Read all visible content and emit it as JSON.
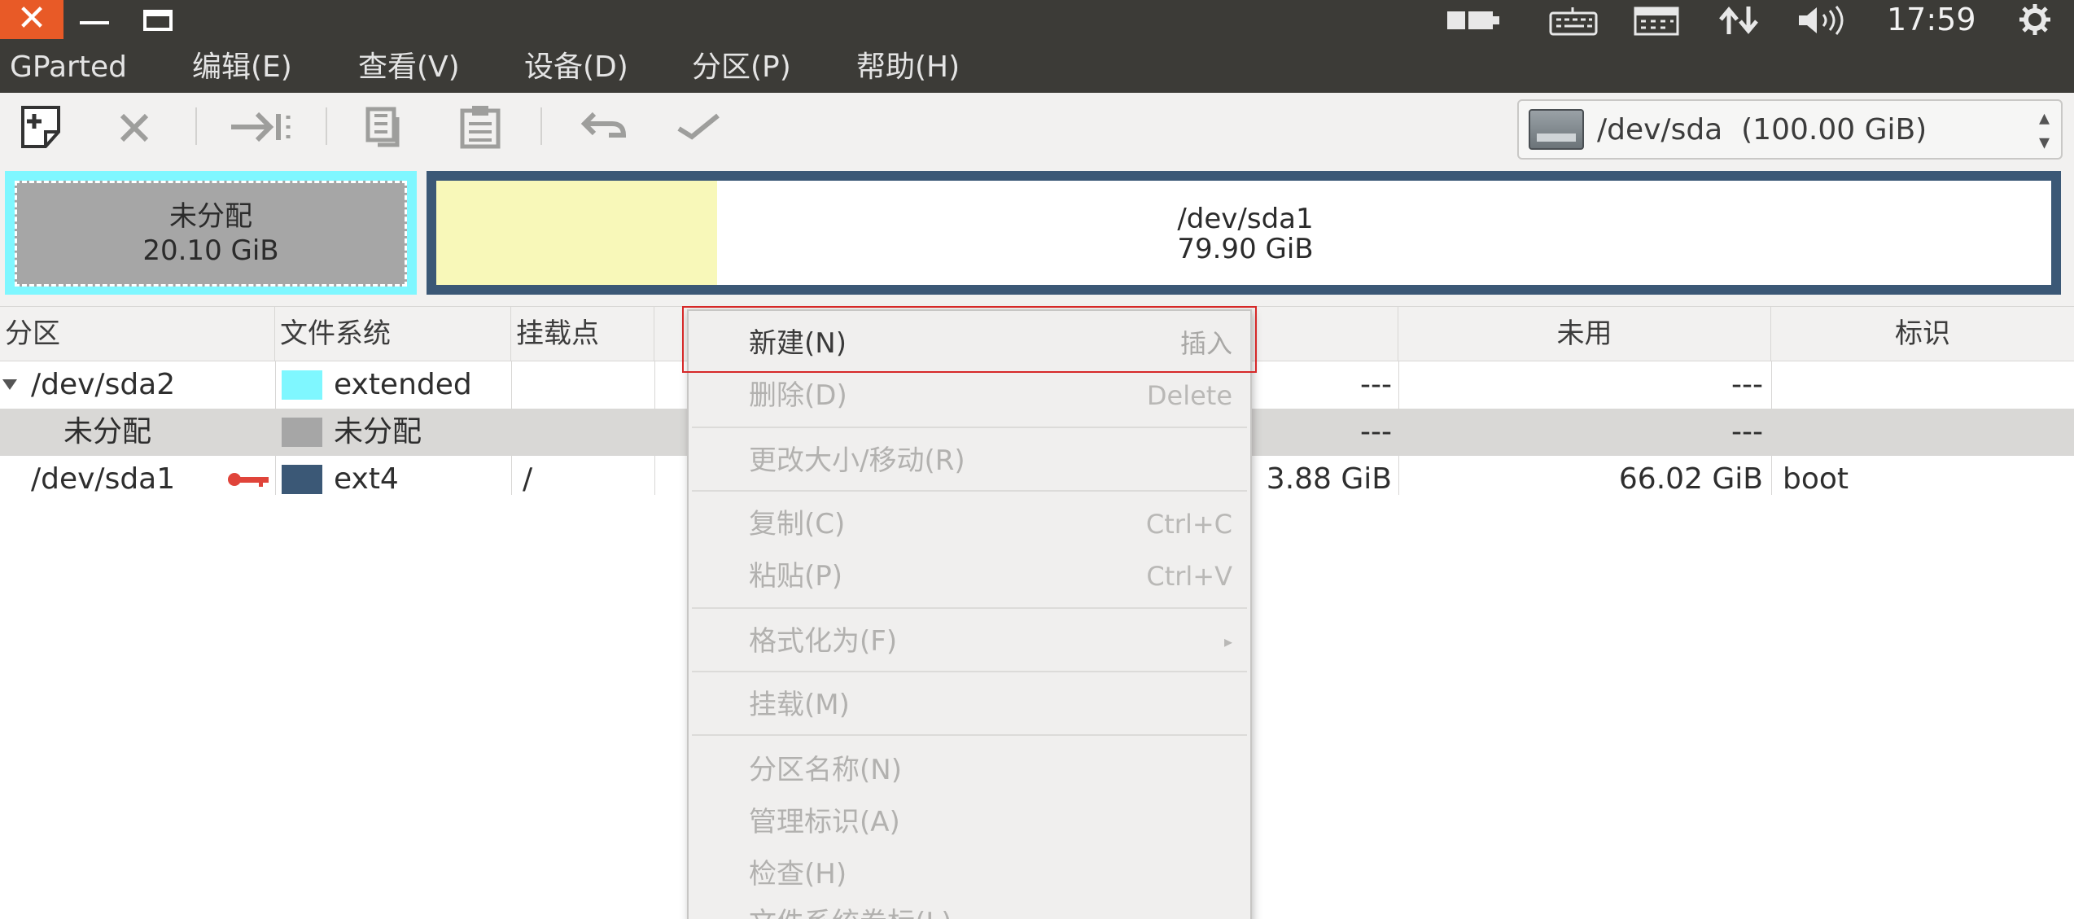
{
  "topbar": {
    "clock": "17:59",
    "close_glyph": "✕",
    "tray_icons": [
      "battery-icon",
      "keyboard-icon",
      "calendar-icon",
      "network-icon",
      "volume-icon",
      "settings-gear-icon"
    ]
  },
  "menubar": {
    "items": [
      "GParted",
      "编辑(E)",
      "查看(V)",
      "设备(D)",
      "分区(P)",
      "帮助(H)"
    ]
  },
  "toolbar": {
    "buttons": [
      "new-partition",
      "delete",
      "resize-move",
      "copy",
      "paste",
      "undo",
      "apply"
    ],
    "device_label": "/dev/sda  (100.00 GiB)"
  },
  "partition_map": {
    "unallocated": {
      "label": "未分配",
      "size": "20.10 GiB"
    },
    "sda1": {
      "label": "/dev/sda1",
      "size": "79.90 GiB",
      "used_fraction": 0.174
    }
  },
  "table": {
    "headers": [
      "分区",
      "文件系统",
      "挂载点",
      "",
      "未用",
      "标识"
    ],
    "rows": [
      {
        "partition": "/dev/sda2",
        "fs": "extended",
        "mount": "",
        "used": "---",
        "unused": "---",
        "flags": "",
        "swatch": "#7ff7ff",
        "expanded": true
      },
      {
        "partition": "未分配",
        "fs": "未分配",
        "mount": "",
        "used": "---",
        "unused": "---",
        "flags": "",
        "swatch": "#a6a6a6"
      },
      {
        "partition": "/dev/sda1",
        "fs": "ext4",
        "mount": "/",
        "used": "3.88 GiB",
        "unused": "66.02 GiB",
        "flags": "boot",
        "swatch": "#3b5876",
        "locked": true
      }
    ]
  },
  "context_menu": {
    "items": [
      {
        "label": "新建(N)",
        "accel": "插入",
        "enabled": true
      },
      {
        "label": "删除(D)",
        "accel": "Delete",
        "enabled": false
      },
      {
        "label": "更改大小/移动(R)",
        "accel": "",
        "enabled": false
      },
      {
        "label": "复制(C)",
        "accel": "Ctrl+C",
        "enabled": false
      },
      {
        "label": "粘贴(P)",
        "accel": "Ctrl+V",
        "enabled": false
      },
      {
        "label": "格式化为(F)",
        "accel": "▸",
        "enabled": false
      },
      {
        "label": "挂载(M)",
        "accel": "",
        "enabled": false
      },
      {
        "label": "分区名称(N)",
        "accel": "",
        "enabled": false
      },
      {
        "label": "管理标识(A)",
        "accel": "",
        "enabled": false
      },
      {
        "label": "检查(H)",
        "accel": "",
        "enabled": false
      },
      {
        "label": "文件系统卷标(L)",
        "accel": "",
        "enabled": false
      }
    ]
  },
  "colors": {
    "panel": "#3c3b37",
    "close_button": "#e85a27",
    "extended": "#7ff7ff",
    "unallocated": "#a6a6a6",
    "ext4": "#3b5876",
    "used_space": "#f8f8b9",
    "highlight_box": "#d62828"
  }
}
